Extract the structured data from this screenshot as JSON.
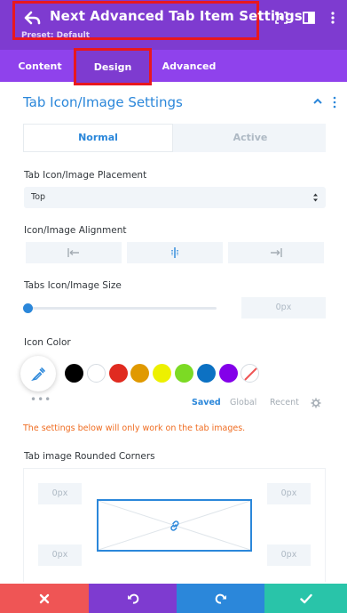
{
  "header": {
    "title": "Next Advanced Tab Item Settings",
    "preset": "Preset: Default",
    "icons": [
      "back-arrow-icon",
      "fullscreen-icon",
      "split-view-icon",
      "more-options-icon"
    ],
    "colors": {
      "background": "#7e3bd0",
      "highlight": "#e8171f"
    }
  },
  "tabs": {
    "items": [
      {
        "label": "Content"
      },
      {
        "label": "Design",
        "active": true
      },
      {
        "label": "Advanced"
      }
    ],
    "colors": {
      "bar": "#8f42ec",
      "active": "#7e3bd0"
    }
  },
  "section": {
    "title": "Tab Icon/Image Settings",
    "state_toggle": {
      "normal": "Normal",
      "active": "Active",
      "selected": "Normal"
    }
  },
  "fields": {
    "placement": {
      "label": "Tab Icon/Image Placement",
      "value": "Top"
    },
    "alignment": {
      "label": "Icon/Image Alignment",
      "options": [
        "align-left-icon",
        "align-center-icon",
        "align-right-icon"
      ]
    },
    "size": {
      "label": "Tabs Icon/Image Size",
      "value": "0px",
      "slider_fraction": 0
    },
    "icon_color": {
      "label": "Icon Color",
      "swatches": [
        "#000000",
        "#ffffff",
        "#e02b20",
        "#e09900",
        "#edf000",
        "#7cda24",
        "#0c71c3",
        "#8300e9",
        "none"
      ],
      "palette_tabs": [
        "Saved",
        "Global",
        "Recent"
      ],
      "palette_selected": "Saved"
    },
    "notice": "The settings below will only work on the tab images.",
    "rounded_corners": {
      "label": "Tab image Rounded Corners",
      "top_left": "0px",
      "top_right": "0px",
      "bottom_left": "0px",
      "bottom_right": "0px"
    }
  },
  "actions": {
    "cancel": {
      "icon": "close-icon",
      "color": "#ef5555"
    },
    "undo": {
      "icon": "undo-icon",
      "color": "#7e3bd0"
    },
    "redo": {
      "icon": "redo-icon",
      "color": "#2b87da"
    },
    "save": {
      "icon": "check-icon",
      "color": "#29c4a9"
    }
  },
  "accent": "#2b87da"
}
